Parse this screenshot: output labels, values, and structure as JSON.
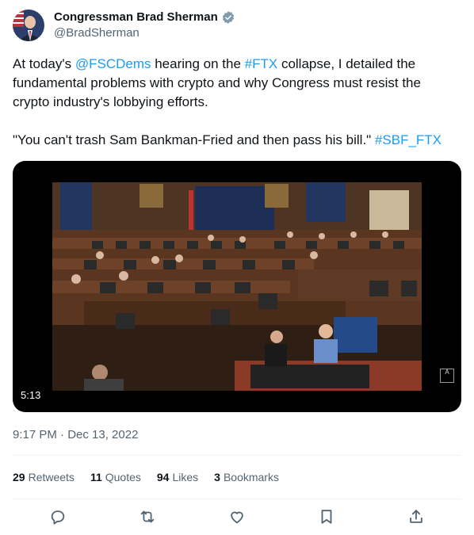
{
  "author": {
    "name": "Congressman Brad Sherman",
    "handle": "@BradSherman",
    "verified_icon": "verified-badge-icon"
  },
  "text": {
    "p1_a": "At today's ",
    "p1_link1": "@FSCDems",
    "p1_b": " hearing on the ",
    "p1_link2": "#FTX",
    "p1_c": " collapse, I detailed the fundamental problems with crypto and why Congress must resist the crypto industry's lobbying efforts.",
    "p2_a": "\"You can't trash Sam Bankman-Fried and then pass his bill.\" ",
    "p2_link": "#SBF_FTX"
  },
  "video": {
    "duration": "5:13"
  },
  "timestamp": "9:17 PM · Dec 13, 2022",
  "stats": {
    "retweets_count": "29",
    "retweets_label": "Retweets",
    "quotes_count": "11",
    "quotes_label": "Quotes",
    "likes_count": "94",
    "likes_label": "Likes",
    "bookmarks_count": "3",
    "bookmarks_label": "Bookmarks"
  },
  "colors": {
    "link": "#1d9bf0",
    "secondary_text": "#536471",
    "text": "#0f1419"
  }
}
